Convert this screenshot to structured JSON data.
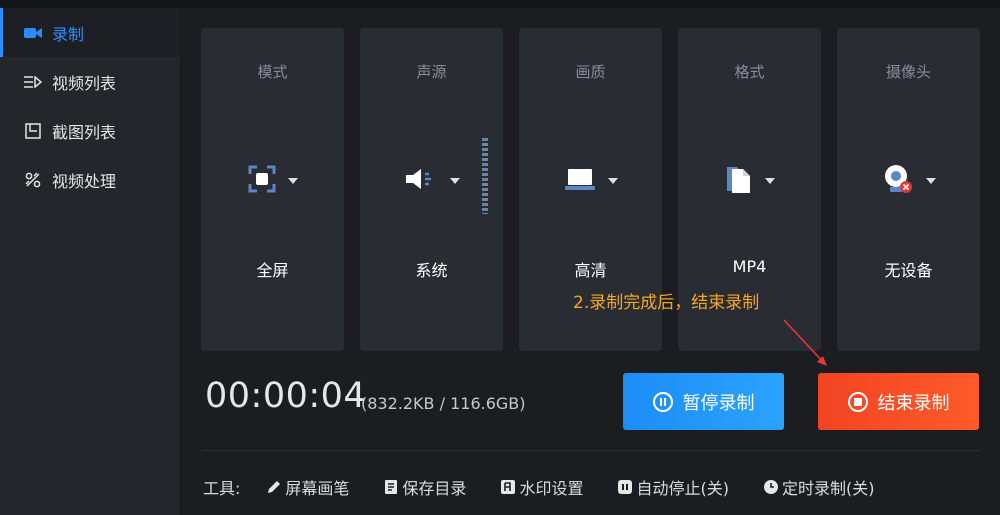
{
  "sidebar": {
    "items": [
      {
        "label": "录制",
        "icon": "video-camera-icon",
        "active": true
      },
      {
        "label": "视频列表",
        "icon": "video-list-icon",
        "active": false
      },
      {
        "label": "截图列表",
        "icon": "screenshot-list-icon",
        "active": false
      },
      {
        "label": "视频处理",
        "icon": "video-tools-icon",
        "active": false
      }
    ]
  },
  "settings": {
    "mode": {
      "title": "模式",
      "value": "全屏",
      "icon": "fullscreen-icon"
    },
    "audio": {
      "title": "声源",
      "value": "系统",
      "icon": "speaker-icon"
    },
    "quality": {
      "title": "画质",
      "value": "高清",
      "icon": "monitor-icon"
    },
    "format": {
      "title": "格式",
      "value": "MP4",
      "icon": "file-icon"
    },
    "camera": {
      "title": "摄像头",
      "value": "无设备",
      "icon": "webcam-icon"
    }
  },
  "annotation": {
    "text": "2.录制完成后，结束录制"
  },
  "status": {
    "timer": "00:00:04",
    "size": "(832.2KB / 116.6GB)"
  },
  "actions": {
    "pause_label": "暂停录制",
    "stop_label": "结束录制"
  },
  "tools": {
    "label": "工具:",
    "items": [
      {
        "label": "屏幕画笔",
        "icon": "pen-icon"
      },
      {
        "label": "保存目录",
        "icon": "folder-icon"
      },
      {
        "label": "水印设置",
        "icon": "watermark-icon"
      },
      {
        "label": "自动停止(关)",
        "icon": "auto-stop-icon"
      },
      {
        "label": "定时录制(关)",
        "icon": "clock-icon"
      }
    ]
  },
  "colors": {
    "accent": "#2b8cff",
    "pause_button": "#1d8df5",
    "stop_button": "#f24422",
    "annotation": "#f5a623",
    "camera_error": "#e53935"
  }
}
